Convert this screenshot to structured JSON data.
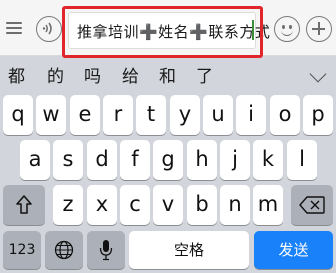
{
  "input_bar": {
    "menu_icon": "list-menu-icon",
    "voice_icon": "voice-input-icon",
    "text_value": "推拿培训➕姓名➕联系方式",
    "emoji_icon": "emoji-icon",
    "more_icon": "plus-icon",
    "highlight_color": "#e0262a"
  },
  "candidates": {
    "items": [
      "都",
      "的",
      "吗",
      "给",
      "和",
      "了"
    ],
    "expand_icon": "chevron-down-icon"
  },
  "keyboard": {
    "row1": [
      "q",
      "w",
      "e",
      "r",
      "t",
      "y",
      "u",
      "i",
      "o",
      "p"
    ],
    "row2": [
      "a",
      "s",
      "d",
      "f",
      "g",
      "h",
      "j",
      "k",
      "l"
    ],
    "row3": [
      "z",
      "x",
      "c",
      "v",
      "b",
      "n",
      "m"
    ],
    "numbers_label": "123",
    "space_label": "空格",
    "send_label": "发送",
    "send_color": "#1982fb",
    "shift_icon": "shift-icon",
    "delete_icon": "backspace-icon",
    "globe_icon": "globe-icon",
    "mic_icon": "microphone-icon"
  }
}
